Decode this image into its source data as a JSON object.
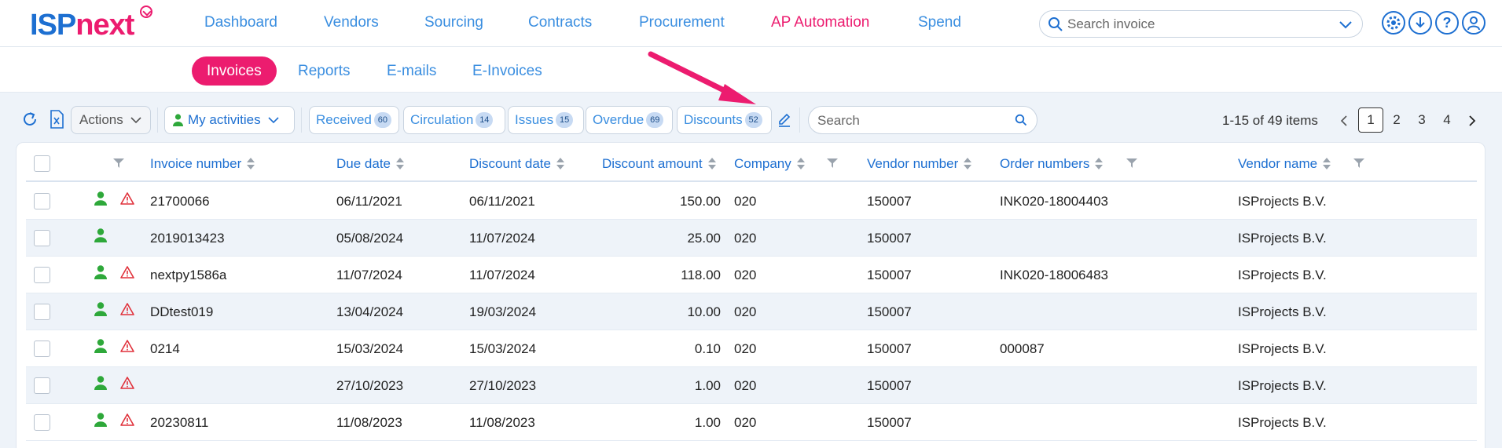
{
  "app": {
    "logo_part1": "ISP",
    "logo_part2": "next"
  },
  "nav": {
    "items": [
      {
        "label": "Dashboard"
      },
      {
        "label": "Vendors"
      },
      {
        "label": "Sourcing"
      },
      {
        "label": "Contracts"
      },
      {
        "label": "Procurement"
      },
      {
        "label": "AP Automation",
        "active": true
      },
      {
        "label": "Spend"
      }
    ],
    "search_placeholder": "Search invoice"
  },
  "subnav": {
    "tabs": [
      {
        "label": "Invoices",
        "active": true
      },
      {
        "label": "Reports"
      },
      {
        "label": "E-mails"
      },
      {
        "label": "E-Invoices"
      }
    ]
  },
  "toolbar": {
    "actions_label": "Actions",
    "activities_label": "My activities",
    "filters": [
      {
        "label": "Received",
        "count": "60"
      },
      {
        "label": "Circulation",
        "count": "14"
      },
      {
        "label": "Issues",
        "count": "15"
      },
      {
        "label": "Overdue",
        "count": "69"
      },
      {
        "label": "Discounts",
        "count": "52"
      }
    ],
    "search_placeholder": "Search"
  },
  "pagination": {
    "summary": "1-15 of 49 items",
    "pages": [
      "1",
      "2",
      "3",
      "4"
    ],
    "current": "1"
  },
  "table": {
    "columns": [
      "Invoice number",
      "Due date",
      "Discount date",
      "Discount amount",
      "Company",
      "Vendor number",
      "Order numbers",
      "Vendor name"
    ],
    "rows": [
      {
        "warning": true,
        "invoice": "21700066",
        "due": "06/11/2021",
        "discount_date": "06/11/2021",
        "amount": "150.00",
        "company": "020",
        "vendor_no": "150007",
        "orders": "INK020-18004403",
        "vendor": "ISProjects B.V."
      },
      {
        "warning": false,
        "invoice": "2019013423",
        "due": "05/08/2024",
        "discount_date": "11/07/2024",
        "amount": "25.00",
        "company": "020",
        "vendor_no": "150007",
        "orders": "",
        "vendor": "ISProjects B.V."
      },
      {
        "warning": true,
        "invoice": "nextpy1586a",
        "due": "11/07/2024",
        "discount_date": "11/07/2024",
        "amount": "118.00",
        "company": "020",
        "vendor_no": "150007",
        "orders": "INK020-18006483",
        "vendor": "ISProjects B.V."
      },
      {
        "warning": true,
        "invoice": "DDtest019",
        "due": "13/04/2024",
        "discount_date": "19/03/2024",
        "amount": "10.00",
        "company": "020",
        "vendor_no": "150007",
        "orders": "",
        "vendor": "ISProjects B.V."
      },
      {
        "warning": true,
        "invoice": "0214",
        "due": "15/03/2024",
        "discount_date": "15/03/2024",
        "amount": "0.10",
        "company": "020",
        "vendor_no": "150007",
        "orders": "000087",
        "vendor": "ISProjects B.V."
      },
      {
        "warning": true,
        "invoice": "",
        "due": "27/10/2023",
        "discount_date": "27/10/2023",
        "amount": "1.00",
        "company": "020",
        "vendor_no": "150007",
        "orders": "",
        "vendor": "ISProjects B.V."
      },
      {
        "warning": true,
        "invoice": "20230811",
        "due": "11/08/2023",
        "discount_date": "11/08/2023",
        "amount": "1.00",
        "company": "020",
        "vendor_no": "150007",
        "orders": "",
        "vendor": "ISProjects B.V."
      }
    ]
  },
  "colors": {
    "brand_blue": "#1d6fd1",
    "brand_pink": "#ec1c6f",
    "owner_green": "#2ea83a",
    "warning_red": "#e0313b"
  }
}
